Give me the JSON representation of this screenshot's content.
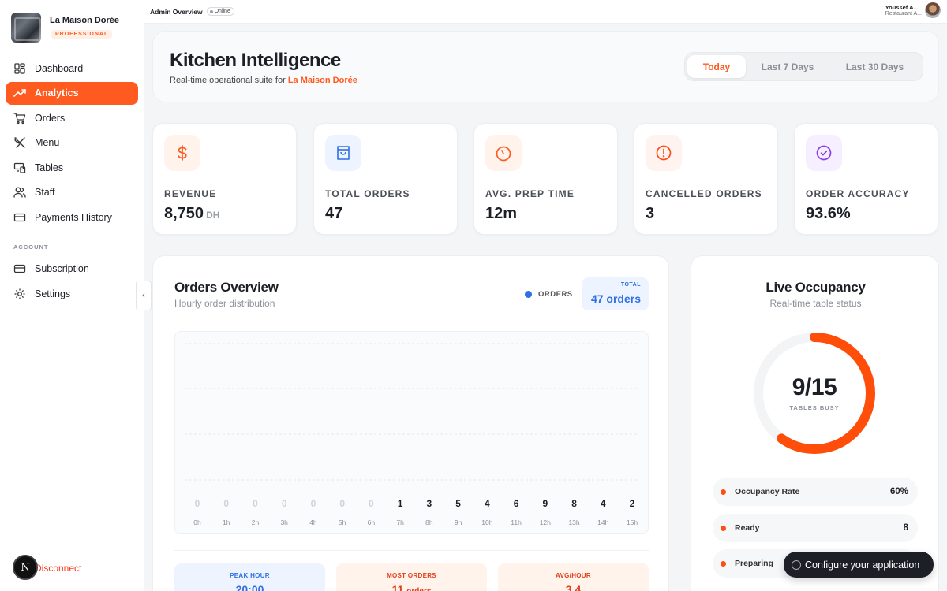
{
  "brand": {
    "name": "La Maison Dorée",
    "badge": "PROFESSIONAL"
  },
  "nav": {
    "items": [
      {
        "label": "Dashboard",
        "icon": "grid-icon",
        "active": false
      },
      {
        "label": "Analytics",
        "icon": "trending-up-icon",
        "active": true
      },
      {
        "label": "Orders",
        "icon": "cart-icon",
        "active": false
      },
      {
        "label": "Menu",
        "icon": "utensils-icon",
        "active": false
      },
      {
        "label": "Tables",
        "icon": "tables-icon",
        "active": false
      },
      {
        "label": "Staff",
        "icon": "users-icon",
        "active": false
      },
      {
        "label": "Payments History",
        "icon": "card-icon",
        "active": false
      }
    ],
    "section_label": "ACCOUNT",
    "account_items": [
      {
        "label": "Subscription",
        "icon": "card-icon"
      },
      {
        "label": "Settings",
        "icon": "gear-icon"
      }
    ],
    "disconnect": "Disconnect",
    "n_badge": "N"
  },
  "topbar": {
    "title": "Admin Overview",
    "status": "Online",
    "user_name": "Youssef A...",
    "user_role": "Restaurant A..."
  },
  "header": {
    "title": "Kitchen Intelligence",
    "subtitle_prefix": "Real-time operational suite for",
    "subtitle_highlight": "La Maison Dorée",
    "ranges": [
      "Today",
      "Last 7 Days",
      "Last 30 Days"
    ],
    "active_range": "Today"
  },
  "stats": [
    {
      "label": "REVENUE",
      "value": "8,750",
      "unit": "DH",
      "icon": "dollar-icon",
      "color": "#ff5a1f",
      "bg": "#fff3ec"
    },
    {
      "label": "TOTAL ORDERS",
      "value": "47",
      "unit": "",
      "icon": "shopping-bag-icon",
      "color": "#2f6fe4",
      "bg": "#eef4ff"
    },
    {
      "label": "AVG. PREP TIME",
      "value": "12m",
      "unit": "",
      "icon": "timer-icon",
      "color": "#ff5a1f",
      "bg": "#fff3ec"
    },
    {
      "label": "CANCELLED ORDERS",
      "value": "3",
      "unit": "",
      "icon": "alert-circle-icon",
      "color": "#ff4d1a",
      "bg": "#fff3ef"
    },
    {
      "label": "ORDER ACCURACY",
      "value": "93.6%",
      "unit": "",
      "icon": "check-circle-icon",
      "color": "#8b3ee8",
      "bg": "#f6efff"
    }
  ],
  "orders_overview": {
    "title": "Orders Overview",
    "subtitle": "Hourly order distribution",
    "legend": "ORDERS",
    "total_label": "TOTAL",
    "total_value": "47 orders",
    "summary": [
      {
        "label": "PEAK HOUR",
        "value": "20:00",
        "unit": "",
        "color": "#2f6fe4",
        "bg": "#eef4ff"
      },
      {
        "label": "MOST ORDERS",
        "value": "11",
        "unit": "orders",
        "color": "#e2401a",
        "bg": "#fff3ec"
      },
      {
        "label": "AVG/HOUR",
        "value": "3.4",
        "unit": "",
        "color": "#e2401a",
        "bg": "#fff3ec"
      }
    ]
  },
  "chart_data": {
    "type": "bar",
    "series": [
      {
        "name": "ORDERS",
        "values": [
          0,
          0,
          0,
          0,
          0,
          0,
          0,
          1,
          3,
          5,
          4,
          6,
          9,
          8,
          4,
          2
        ]
      }
    ],
    "categories": [
      "0h",
      "1h",
      "2h",
      "3h",
      "4h",
      "5h",
      "6h",
      "7h",
      "8h",
      "9h",
      "10h",
      "11h",
      "12h",
      "13h",
      "14h",
      "15h"
    ],
    "values": [
      0,
      0,
      0,
      0,
      0,
      0,
      0,
      1,
      3,
      5,
      4,
      6,
      9,
      8,
      4,
      2
    ],
    "title": "Orders Overview",
    "legend": "top-right",
    "grid": true
  },
  "occupancy": {
    "title": "Live Occupancy",
    "subtitle": "Real-time table status",
    "value": "9/15",
    "busy_label": "TABLES BUSY",
    "fraction": 0.6,
    "rows": [
      {
        "label": "Occupancy Rate",
        "value": "60%"
      },
      {
        "label": "Ready",
        "value": "8"
      },
      {
        "label": "Preparing",
        "value": ""
      }
    ]
  },
  "configure_label": "Configure your application"
}
